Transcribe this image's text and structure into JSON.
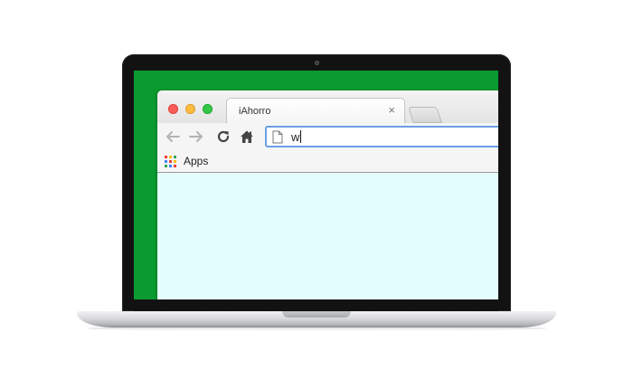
{
  "browser": {
    "tab": {
      "title": "iAhorro",
      "close_glyph": "×"
    },
    "omnibox": {
      "value": "w"
    },
    "bookmarks_bar": {
      "apps_label": "Apps"
    }
  },
  "icons": {
    "back": "back-arrow-icon",
    "forward": "forward-arrow-icon",
    "reload": "reload-icon",
    "home": "home-icon",
    "page": "page-icon",
    "apps": "apps-grid-icon"
  },
  "colors": {
    "desktop_background": "#0b9a2f",
    "page_background": "#e3fdfd",
    "omnibox_focus_border": "#6b9ee4",
    "close_light": "#fc5b57",
    "minimize_light": "#fdbc40",
    "zoom_light": "#33c748"
  }
}
